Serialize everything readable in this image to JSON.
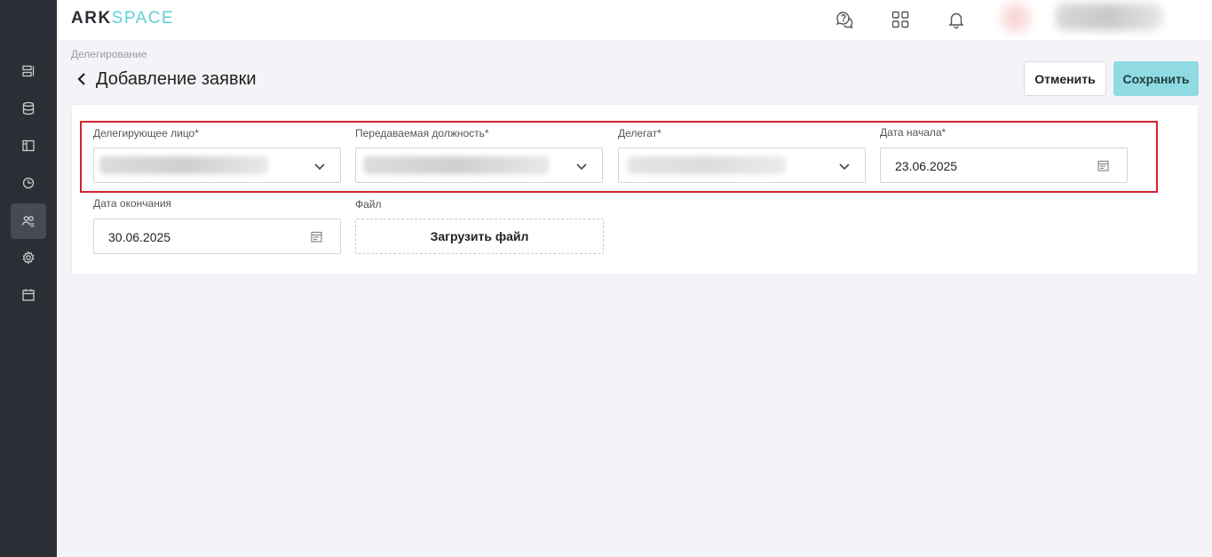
{
  "brand": {
    "logo_part1": "ARK",
    "logo_part2": "SPACE"
  },
  "sidebar": {
    "items": [
      {
        "icon": "list-icon",
        "active": false
      },
      {
        "icon": "database-icon",
        "active": false
      },
      {
        "icon": "layout-icon",
        "active": false
      },
      {
        "icon": "pie-chart-icon",
        "active": false
      },
      {
        "icon": "users-icon",
        "active": true
      },
      {
        "icon": "gear-icon",
        "active": false
      },
      {
        "icon": "calendar-icon",
        "active": false
      }
    ]
  },
  "header": {
    "icons": [
      "help-chat-icon",
      "apps-grid-icon",
      "bell-icon"
    ]
  },
  "page": {
    "breadcrumb": "Делегирование",
    "title": "Добавление заявки",
    "cancel_label": "Отменить",
    "save_label": "Сохранить"
  },
  "form": {
    "delegator_label": "Делегирующее лицо*",
    "position_label": "Передаваемая должность*",
    "delegate_label": "Делегат*",
    "start_date_label": "Дата начала*",
    "start_date_value": "23.06.2025",
    "end_date_label": "Дата окончания",
    "end_date_value": "30.06.2025",
    "file_label": "Файл",
    "upload_label": "Загрузить файл"
  },
  "colors": {
    "sidebar_bg": "#2b2f35",
    "accent": "#8fdbe1",
    "logo_accent": "#5fd0d8",
    "highlight_border": "#d0252c"
  }
}
